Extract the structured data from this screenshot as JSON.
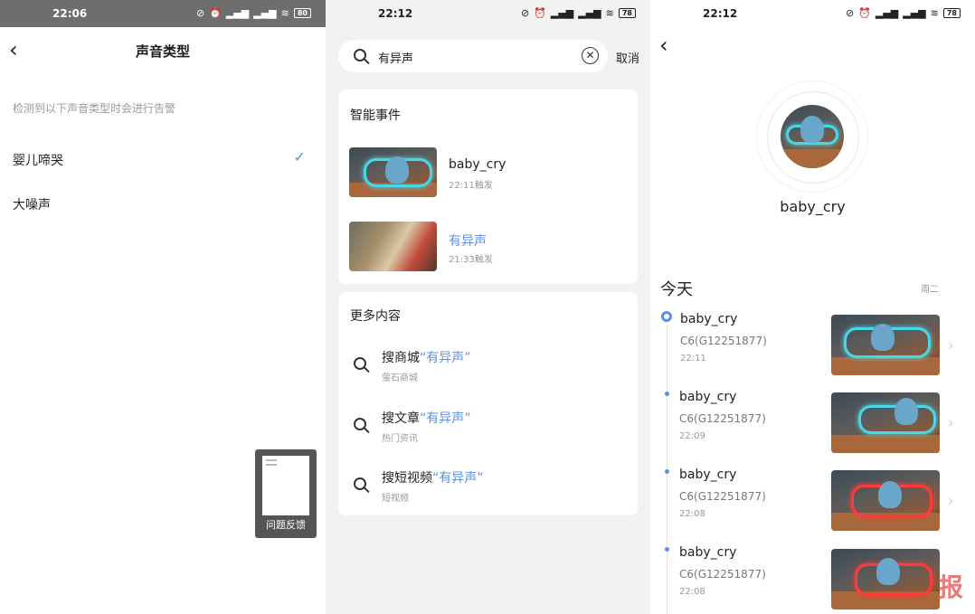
{
  "panel1": {
    "status": {
      "time": "22:06",
      "battery": "80"
    },
    "title": "声音类型",
    "hint": "检测到以下声音类型时会进行告警",
    "options": [
      {
        "label": "婴儿啼哭",
        "checked": true
      },
      {
        "label": "大噪声",
        "checked": false
      }
    ],
    "feedback_label": "问题反馈"
  },
  "panel2": {
    "status": {
      "time": "22:12",
      "battery": "78"
    },
    "search": {
      "query": "有异声",
      "cancel": "取消"
    },
    "smart_events": {
      "title": "智能事件",
      "items": [
        {
          "name": "baby_cry",
          "time": "22:11触发",
          "highlight": false
        },
        {
          "name": "有异声",
          "time": "21:33触发",
          "highlight": true
        }
      ]
    },
    "more": {
      "title": "更多内容",
      "items": [
        {
          "prefix": "搜商城",
          "query": "“有异声”",
          "sub": "萤石商城"
        },
        {
          "prefix": "搜文章",
          "query": "“有异声”",
          "sub": "热门资讯"
        },
        {
          "prefix": "搜短视频",
          "query": "“有异声”",
          "sub": "短视频"
        }
      ]
    }
  },
  "panel3": {
    "status": {
      "time": "22:12",
      "battery": "78"
    },
    "device_name": "baby_cry",
    "today": "今天",
    "weekday": "周二",
    "records": [
      {
        "name": "baby_cry",
        "device": "C6(G12251877)",
        "time": "22:11"
      },
      {
        "name": "baby_cry",
        "device": "C6(G12251877)",
        "time": "22:09"
      },
      {
        "name": "baby_cry",
        "device": "C6(G12251877)",
        "time": "22:08"
      },
      {
        "name": "baby_cry",
        "device": "C6(G12251877)",
        "time": "22:08"
      }
    ],
    "watermark": "报"
  },
  "colors": {
    "accent": "#5b8fe3",
    "status_bar_dark": "#6e6e6e"
  },
  "icons": [
    "back-icon",
    "check-icon",
    "search-icon",
    "clear-icon",
    "chevron-right-icon",
    "wifi-icon",
    "alarm-icon",
    "signal-icon",
    "battery-icon"
  ]
}
